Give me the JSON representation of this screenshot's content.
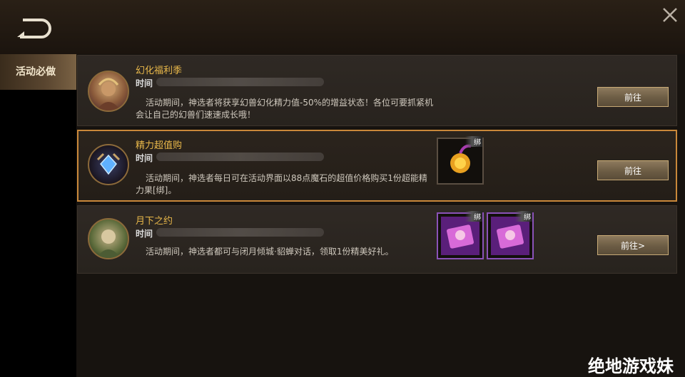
{
  "sidebar": {
    "items": [
      {
        "label": "活动必做",
        "active": true
      }
    ]
  },
  "cards": [
    {
      "title": "幻化福利季",
      "time_label": "时间",
      "description": "活动期间，神选者将获享幻兽幻化精力值-50%的增益状态！各位可要抓紧机会让自己的幻兽们速速成长哦！",
      "button": "前往",
      "rewards": []
    },
    {
      "title": "精力超值购",
      "time_label": "时间",
      "description": "活动期间，神选者每日可在活动界面以88点魔石的超值价格购买1份超能精力果[绑]。",
      "button": "前往",
      "rewards": [
        {
          "icon": "energy-fruit-icon",
          "tag": "绑"
        }
      ]
    },
    {
      "title": "月下之约",
      "time_label": "时间",
      "description": "活动期间，神选者都可与闭月倾城·貂蝉对话，领取1份精美好礼。",
      "button": "前往>",
      "rewards": [
        {
          "icon": "gift-box-icon",
          "tag": "绑"
        },
        {
          "icon": "gift-box-icon",
          "tag": "绑"
        }
      ]
    }
  ],
  "watermark": "绝地游戏妹",
  "colors": {
    "accent": "#e9b84a",
    "selected_border": "#c9883a"
  }
}
